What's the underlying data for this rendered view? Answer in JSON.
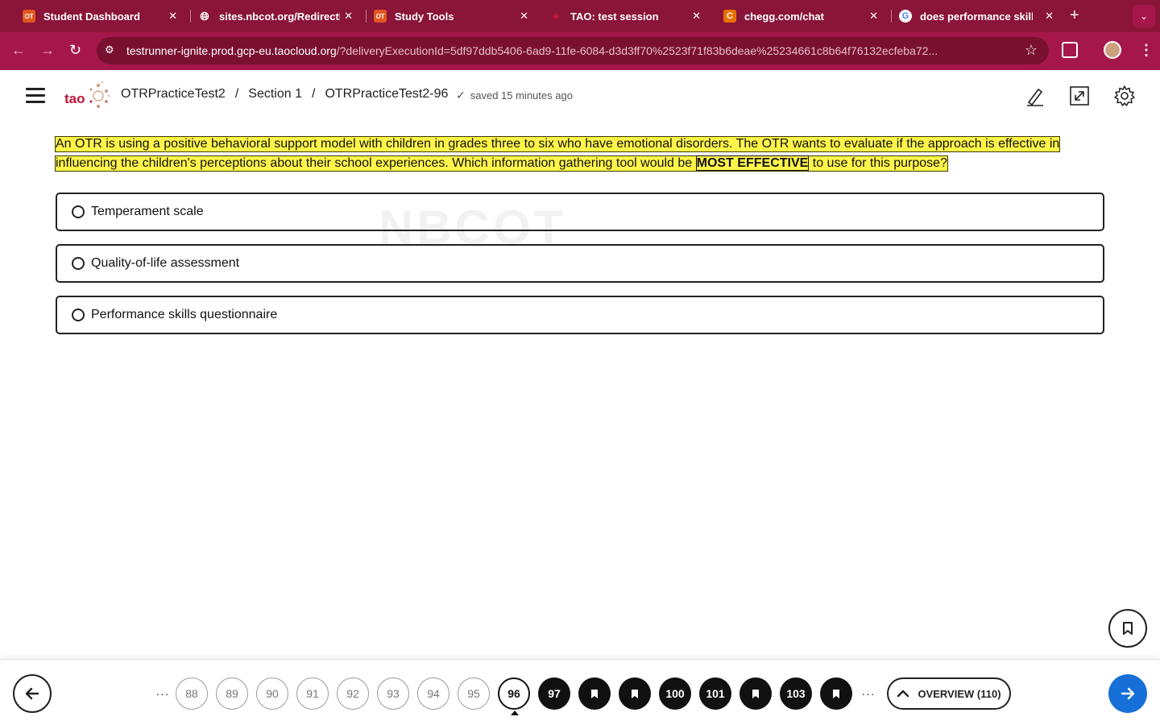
{
  "browser": {
    "tabs": [
      {
        "favicon": "OT",
        "title": "Student Dashboard",
        "fav_color": "#e2561e"
      },
      {
        "favicon": "globe",
        "title": "sites.nbcot.org/RedirectL",
        "fav_color": "#8a1538"
      },
      {
        "favicon": "OT",
        "title": "Study Tools",
        "fav_color": "#e2561e"
      },
      {
        "favicon": "tao",
        "title": "TAO: test session",
        "fav_color": "#c0163a"
      },
      {
        "favicon": "C",
        "title": "chegg.com/chat",
        "fav_color": "#eb7100"
      },
      {
        "favicon": "G",
        "title": "does performance skills c",
        "fav_color": "#ffffff"
      }
    ],
    "url_host": "testrunner-ignite.prod.gcp-eu.taocloud.org",
    "url_rest": "/?deliveryExecutionId=5df97ddb5406-6ad9-11fe-6084-d3d3ff70%2523f71f83b6deae%25234661c8b64f76132ecfeba72..."
  },
  "header": {
    "logo_text": "tao",
    "breadcrumbs": [
      "OTRPracticeTest2",
      "Section 1",
      "OTRPracticeTest2-96"
    ],
    "saved_status": "saved 15 minutes ago"
  },
  "question": {
    "text_before": "An OTR is using a positive behavioral support model with children in grades three to six who have emotional disorders. The OTR wants to evaluate if the approach is effective in influencing the children's perceptions about their school experiences. Which information gathering tool would be",
    "emphasis": "MOST EFFECTIVE",
    "text_after": "to use for this purpose?",
    "watermark": "NBCOT"
  },
  "choices": [
    {
      "label": "Temperament scale"
    },
    {
      "label": "Quality-of-life assessment"
    },
    {
      "label": "Performance skills questionnaire"
    }
  ],
  "pager": {
    "ellipsis": "···",
    "items": [
      {
        "label": "88",
        "state": "visited"
      },
      {
        "label": "89",
        "state": "visited"
      },
      {
        "label": "90",
        "state": "visited"
      },
      {
        "label": "91",
        "state": "visited"
      },
      {
        "label": "92",
        "state": "visited"
      },
      {
        "label": "93",
        "state": "visited"
      },
      {
        "label": "94",
        "state": "visited"
      },
      {
        "label": "95",
        "state": "visited"
      },
      {
        "label": "96",
        "state": "current"
      },
      {
        "label": "97",
        "state": "unseen"
      },
      {
        "label": "",
        "state": "flagged"
      },
      {
        "label": "",
        "state": "flagged"
      },
      {
        "label": "100",
        "state": "unseen"
      },
      {
        "label": "101",
        "state": "unseen"
      },
      {
        "label": "",
        "state": "flagged"
      },
      {
        "label": "103",
        "state": "unseen"
      },
      {
        "label": "",
        "state": "flagged"
      }
    ],
    "overview_label": "OVERVIEW (110)"
  },
  "colors": {
    "accent": "#8a1538",
    "highlight": "#fff54a",
    "next": "#1670d8"
  }
}
